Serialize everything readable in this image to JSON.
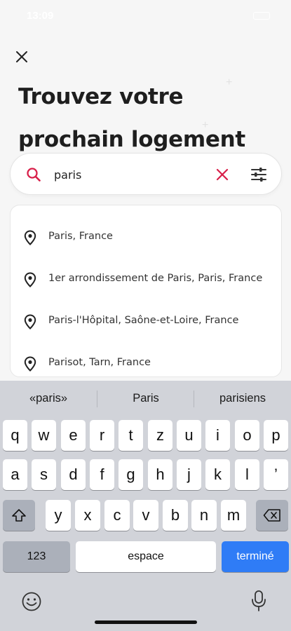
{
  "status_bar": {
    "time": "13:09"
  },
  "header": {
    "title": "Trouvez votre prochain logement"
  },
  "search": {
    "value": "paris",
    "placeholder": ""
  },
  "suggestions": [
    {
      "label": "Paris, France"
    },
    {
      "label": "1er arrondissement de Paris, Paris, France"
    },
    {
      "label": "Paris-l'Hôpital, Saône-et-Loire, France"
    },
    {
      "label": "Parisot, Tarn, France"
    }
  ],
  "keyboard": {
    "predictions": [
      "«paris»",
      "Paris",
      "parisiens"
    ],
    "row1": [
      "q",
      "w",
      "e",
      "r",
      "t",
      "z",
      "u",
      "i",
      "o",
      "p"
    ],
    "row2": [
      "a",
      "s",
      "d",
      "f",
      "g",
      "h",
      "j",
      "k",
      "l",
      "’"
    ],
    "row3": [
      "y",
      "x",
      "c",
      "v",
      "b",
      "n",
      "m"
    ],
    "numbers_label": "123",
    "space_label": "espace",
    "done_label": "terminé"
  },
  "colors": {
    "accent": "#d8204a",
    "keyboard_blue": "#2f7cf6"
  }
}
